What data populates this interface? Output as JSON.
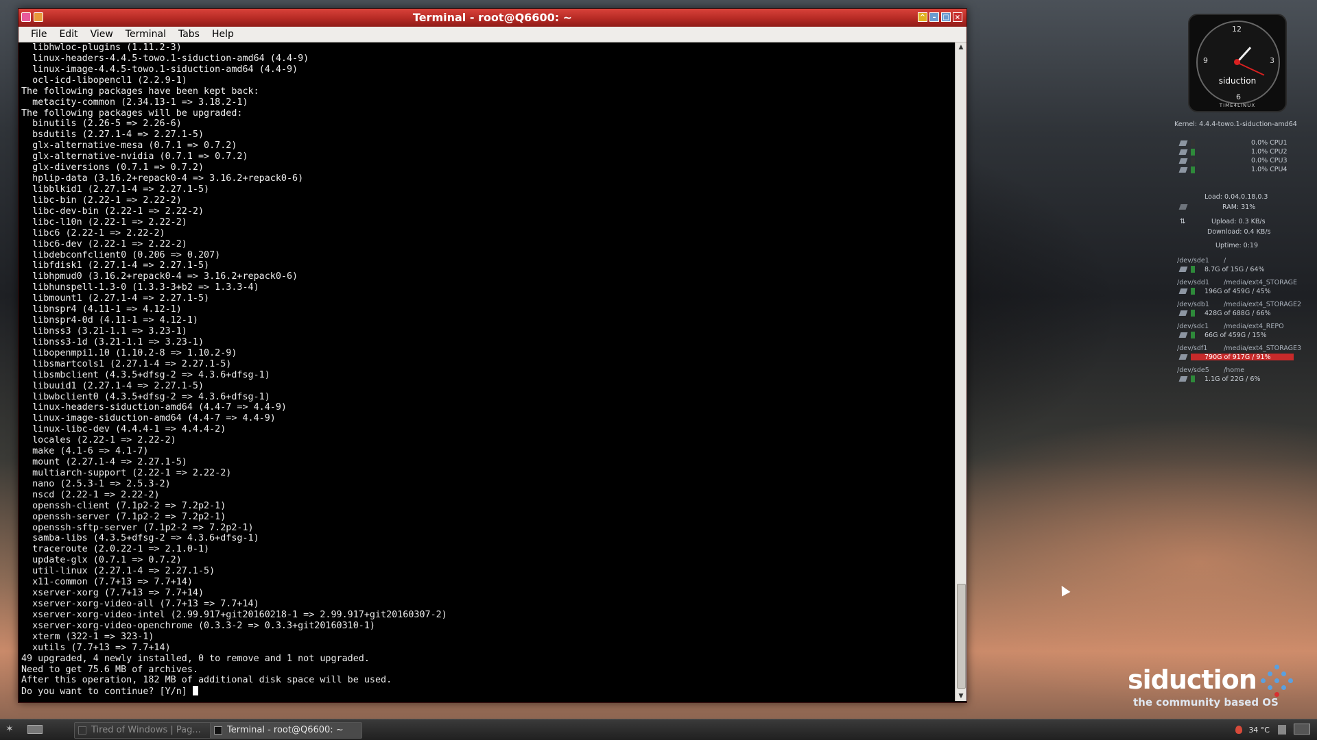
{
  "window": {
    "title": "Terminal - root@Q6600: ~",
    "menu": [
      "File",
      "Edit",
      "View",
      "Terminal",
      "Tabs",
      "Help"
    ]
  },
  "terminal": {
    "lines": [
      "  libhwloc-plugins (1.11.2-3)",
      "  linux-headers-4.4.5-towo.1-siduction-amd64 (4.4-9)",
      "  linux-image-4.4.5-towo.1-siduction-amd64 (4.4-9)",
      "  ocl-icd-libopencl1 (2.2.9-1)",
      "The following packages have been kept back:",
      "  metacity-common (2.34.13-1 => 3.18.2-1)",
      "The following packages will be upgraded:",
      "  binutils (2.26-5 => 2.26-6)",
      "  bsdutils (2.27.1-4 => 2.27.1-5)",
      "  glx-alternative-mesa (0.7.1 => 0.7.2)",
      "  glx-alternative-nvidia (0.7.1 => 0.7.2)",
      "  glx-diversions (0.7.1 => 0.7.2)",
      "  hplip-data (3.16.2+repack0-4 => 3.16.2+repack0-6)",
      "  libblkid1 (2.27.1-4 => 2.27.1-5)",
      "  libc-bin (2.22-1 => 2.22-2)",
      "  libc-dev-bin (2.22-1 => 2.22-2)",
      "  libc-l10n (2.22-1 => 2.22-2)",
      "  libc6 (2.22-1 => 2.22-2)",
      "  libc6-dev (2.22-1 => 2.22-2)",
      "  libdebconfclient0 (0.206 => 0.207)",
      "  libfdisk1 (2.27.1-4 => 2.27.1-5)",
      "  libhpmud0 (3.16.2+repack0-4 => 3.16.2+repack0-6)",
      "  libhunspell-1.3-0 (1.3.3-3+b2 => 1.3.3-4)",
      "  libmount1 (2.27.1-4 => 2.27.1-5)",
      "  libnspr4 (4.11-1 => 4.12-1)",
      "  libnspr4-0d (4.11-1 => 4.12-1)",
      "  libnss3 (3.21-1.1 => 3.23-1)",
      "  libnss3-1d (3.21-1.1 => 3.23-1)",
      "  libopenmpi1.10 (1.10.2-8 => 1.10.2-9)",
      "  libsmartcols1 (2.27.1-4 => 2.27.1-5)",
      "  libsmbclient (4.3.5+dfsg-2 => 4.3.6+dfsg-1)",
      "  libuuid1 (2.27.1-4 => 2.27.1-5)",
      "  libwbclient0 (4.3.5+dfsg-2 => 4.3.6+dfsg-1)",
      "  linux-headers-siduction-amd64 (4.4-7 => 4.4-9)",
      "  linux-image-siduction-amd64 (4.4-7 => 4.4-9)",
      "  linux-libc-dev (4.4.4-1 => 4.4.4-2)",
      "  locales (2.22-1 => 2.22-2)",
      "  make (4.1-6 => 4.1-7)",
      "  mount (2.27.1-4 => 2.27.1-5)",
      "  multiarch-support (2.22-1 => 2.22-2)",
      "  nano (2.5.3-1 => 2.5.3-2)",
      "  nscd (2.22-1 => 2.22-2)",
      "  openssh-client (7.1p2-2 => 7.2p2-1)",
      "  openssh-server (7.1p2-2 => 7.2p2-1)",
      "  openssh-sftp-server (7.1p2-2 => 7.2p2-1)",
      "  samba-libs (4.3.5+dfsg-2 => 4.3.6+dfsg-1)",
      "  traceroute (2.0.22-1 => 2.1.0-1)",
      "  update-glx (0.7.1 => 0.7.2)",
      "  util-linux (2.27.1-4 => 2.27.1-5)",
      "  x11-common (7.7+13 => 7.7+14)",
      "  xserver-xorg (7.7+13 => 7.7+14)",
      "  xserver-xorg-video-all (7.7+13 => 7.7+14)",
      "  xserver-xorg-video-intel (2.99.917+git20160218-1 => 2.99.917+git20160307-2)",
      "  xserver-xorg-video-openchrome (0.3.3-2 => 0.3.3+git20160310-1)",
      "  xterm (322-1 => 323-1)",
      "  xutils (7.7+13 => 7.7+14)",
      "49 upgraded, 4 newly installed, 0 to remove and 1 not upgraded.",
      "Need to get 75.6 MB of archives.",
      "After this operation, 182 MB of additional disk space will be used."
    ],
    "prompt": "Do you want to continue? [Y/n] "
  },
  "clock": {
    "brand": "siduction",
    "footer": "TIME4LINUX",
    "n12": "12",
    "n3": "3",
    "n6": "6",
    "n9": "9"
  },
  "conky": {
    "kernel": "Kernel: 4.4.4-towo.1-siduction-amd64",
    "cpus": [
      {
        "label": "0.0% CPU1",
        "usage": 0.0
      },
      {
        "label": "1.0% CPU2",
        "usage": 1.0
      },
      {
        "label": "0.0% CPU3",
        "usage": 0.0
      },
      {
        "label": "1.0% CPU4",
        "usage": 1.0
      }
    ],
    "load": "Load: 0.04,0.18,0.3",
    "ram": "RAM: 31%",
    "upload": "Upload: 0.3 KB/s",
    "download": "Download: 0.4 KB/s",
    "uptime": "Uptime: 0:19",
    "disks": [
      {
        "dev": "/dev/sde1",
        "mount": "/",
        "usage": "8.7G of 15G / 64%",
        "percent": 64
      },
      {
        "dev": "/dev/sdd1",
        "mount": "/media/ext4_STORAGE",
        "usage": "196G of 459G / 45%",
        "percent": 45
      },
      {
        "dev": "/dev/sdb1",
        "mount": "/media/ext4_STORAGE2",
        "usage": "428G of 688G / 66%",
        "percent": 66
      },
      {
        "dev": "/dev/sdc1",
        "mount": "/media/ext4_REPO",
        "usage": "66G of 459G / 15%",
        "percent": 15
      },
      {
        "dev": "/dev/sdf1",
        "mount": "/media/ext4_STORAGE3",
        "usage": "790G of 917G / 91%",
        "percent": 91
      },
      {
        "dev": "/dev/sde5",
        "mount": "/home",
        "usage": "1.1G of 22G / 6%",
        "percent": 6
      }
    ]
  },
  "logo": {
    "name": "siduction",
    "tagline": "the community based OS"
  },
  "taskbar": {
    "tasks": [
      "Tired of Windows | Pag...",
      "Terminal - root@Q6600: ~"
    ],
    "temp": "34 °C"
  },
  "colors": {
    "titlebar": "#c0332c",
    "disk_critical": "#c82a2a",
    "disk_bar": "#2e8a3a"
  }
}
